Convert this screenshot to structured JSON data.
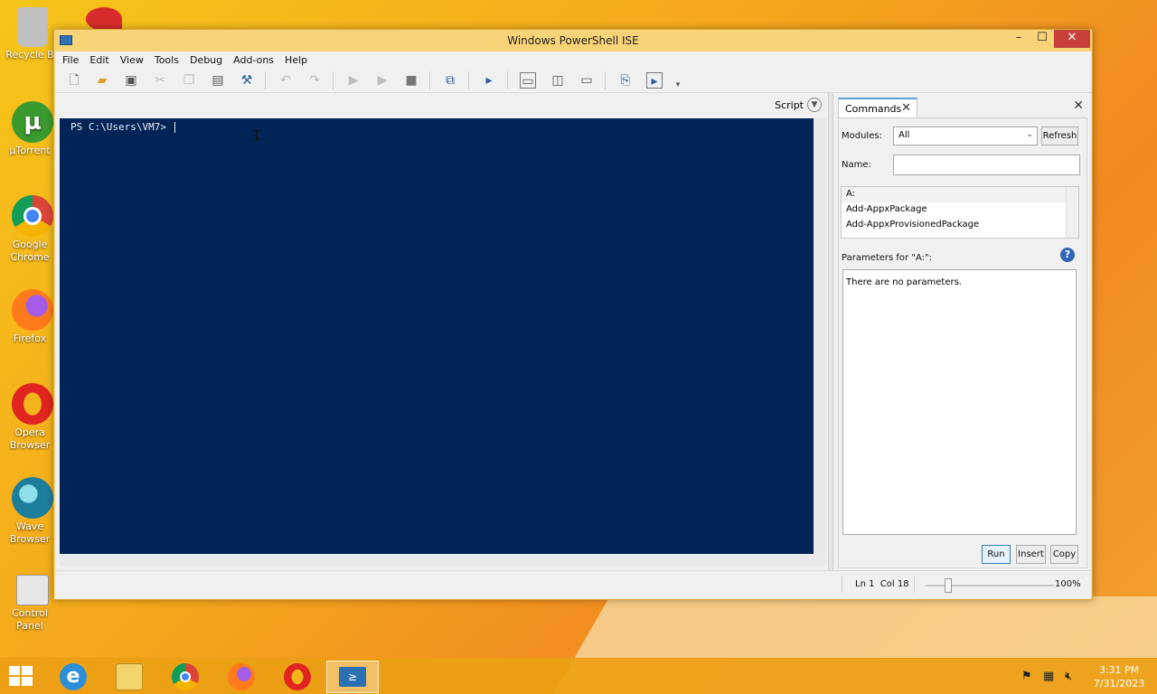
{
  "desktop": {
    "icons": [
      {
        "label": "Recycle B",
        "color": "#bfbfbf"
      },
      {
        "label": "µTorrent",
        "color": "#3b9a2f"
      },
      {
        "label": "Google\nChrome",
        "color": "#3f85f4"
      },
      {
        "label": "Firefox",
        "color": "#e56a22"
      },
      {
        "label": "Opera\nBrowser",
        "color": "#e0241f"
      },
      {
        "label": "Wave\nBrowser",
        "color": "#1d7e9c"
      },
      {
        "label": "Control\nPanel",
        "color": "#d8d8d8"
      }
    ]
  },
  "window": {
    "title": "Windows PowerShell ISE",
    "controls": {
      "minimize": "–",
      "maximize": "☐",
      "close": "✕"
    }
  },
  "menu": [
    "File",
    "Edit",
    "View",
    "Tools",
    "Debug",
    "Add-ons",
    "Help"
  ],
  "script_pane": {
    "label": "Script",
    "toggle_icon": "chevron-circle-down-icon"
  },
  "console": {
    "prompt": "PS C:\\Users\\VM7> "
  },
  "commands": {
    "tab_label": "Commands",
    "modules_label": "Modules:",
    "modules_value": "All",
    "refresh_label": "Refresh",
    "name_label": "Name:",
    "name_value": "",
    "list": [
      "A:",
      "Add-AppxPackage",
      "Add-AppxProvisionedPackage"
    ],
    "params_label": "Parameters for \"A:\":",
    "params_text": "There are no parameters.",
    "help_glyph": "?",
    "buttons": {
      "run": "Run",
      "insert": "Insert",
      "copy": "Copy"
    }
  },
  "status": {
    "position": "Ln 1  Col 18",
    "zoom": "100%",
    "zoom_level": 0.2
  },
  "taskbar": {
    "items": [
      "internet-explorer",
      "file-explorer",
      "chrome",
      "firefox",
      "opera",
      "powershell-ise"
    ],
    "clock_time": "3:31 PM",
    "clock_date": "7/31/2023"
  },
  "colors": {
    "console_bg": "#012456",
    "console_fg": "#eeedf0",
    "accent": "#5aa0d6"
  }
}
